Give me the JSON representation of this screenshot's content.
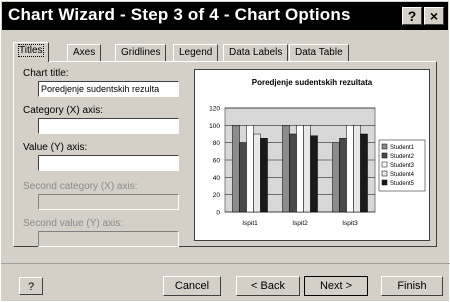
{
  "dialog": {
    "title": "Chart Wizard - Step 3 of 4 - Chart Options",
    "help_glyph": "?",
    "close_glyph": "×"
  },
  "tabs": [
    {
      "label": "Titles",
      "active": true
    },
    {
      "label": "Axes"
    },
    {
      "label": "Gridlines"
    },
    {
      "label": "Legend"
    },
    {
      "label": "Data Labels"
    },
    {
      "label": "Data Table"
    }
  ],
  "fields": {
    "chart_title": {
      "label": "Chart title:",
      "value": "Poredjenje sudentskih rezulta"
    },
    "category_x": {
      "label": "Category (X) axis:",
      "value": ""
    },
    "value_y": {
      "label": "Value (Y) axis:",
      "value": ""
    },
    "second_category": {
      "label": "Second category (X) axis:",
      "value": ""
    },
    "second_value": {
      "label": "Second value (Y) axis:",
      "value": ""
    }
  },
  "buttons": {
    "help": "?",
    "cancel": "Cancel",
    "back": "< Back",
    "next": "Next >",
    "finish": "Finish"
  },
  "chart_data": {
    "type": "bar",
    "title": "Poredjenje sudentskih rezultata",
    "categories": [
      "Ispit1",
      "Ispit2",
      "Ispit3"
    ],
    "ylim": [
      0,
      120
    ],
    "yticks": [
      0,
      20,
      40,
      60,
      80,
      100,
      120
    ],
    "series": [
      {
        "name": "Student1",
        "values": [
          100,
          100,
          80
        ],
        "color": "#8c8c8c"
      },
      {
        "name": "Student2",
        "values": [
          80,
          90,
          85
        ],
        "color": "#4a4a4a"
      },
      {
        "name": "Student3",
        "values": [
          100,
          100,
          100
        ],
        "color": "#ffffff"
      },
      {
        "name": "Student4",
        "values": [
          90,
          100,
          100
        ],
        "color": "#e8e8e8"
      },
      {
        "name": "Student5",
        "values": [
          85,
          88,
          90
        ],
        "color": "#1a1a1a"
      }
    ],
    "legend_position": "right",
    "gridlines": true
  }
}
